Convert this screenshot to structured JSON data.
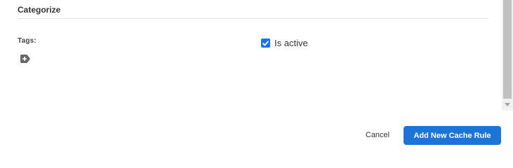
{
  "section": {
    "title": "Categorize"
  },
  "tags": {
    "label": "Tags:",
    "add_icon": "tag-plus-icon"
  },
  "active": {
    "label": "Is active",
    "checked": true,
    "check_icon": "checkmark-icon"
  },
  "footer": {
    "cancel_label": "Cancel",
    "submit_label": "Add New Cache Rule"
  },
  "colors": {
    "primary": "#1b74d6",
    "checkbox": "#1a73e8",
    "divider": "#e4e4e4"
  }
}
